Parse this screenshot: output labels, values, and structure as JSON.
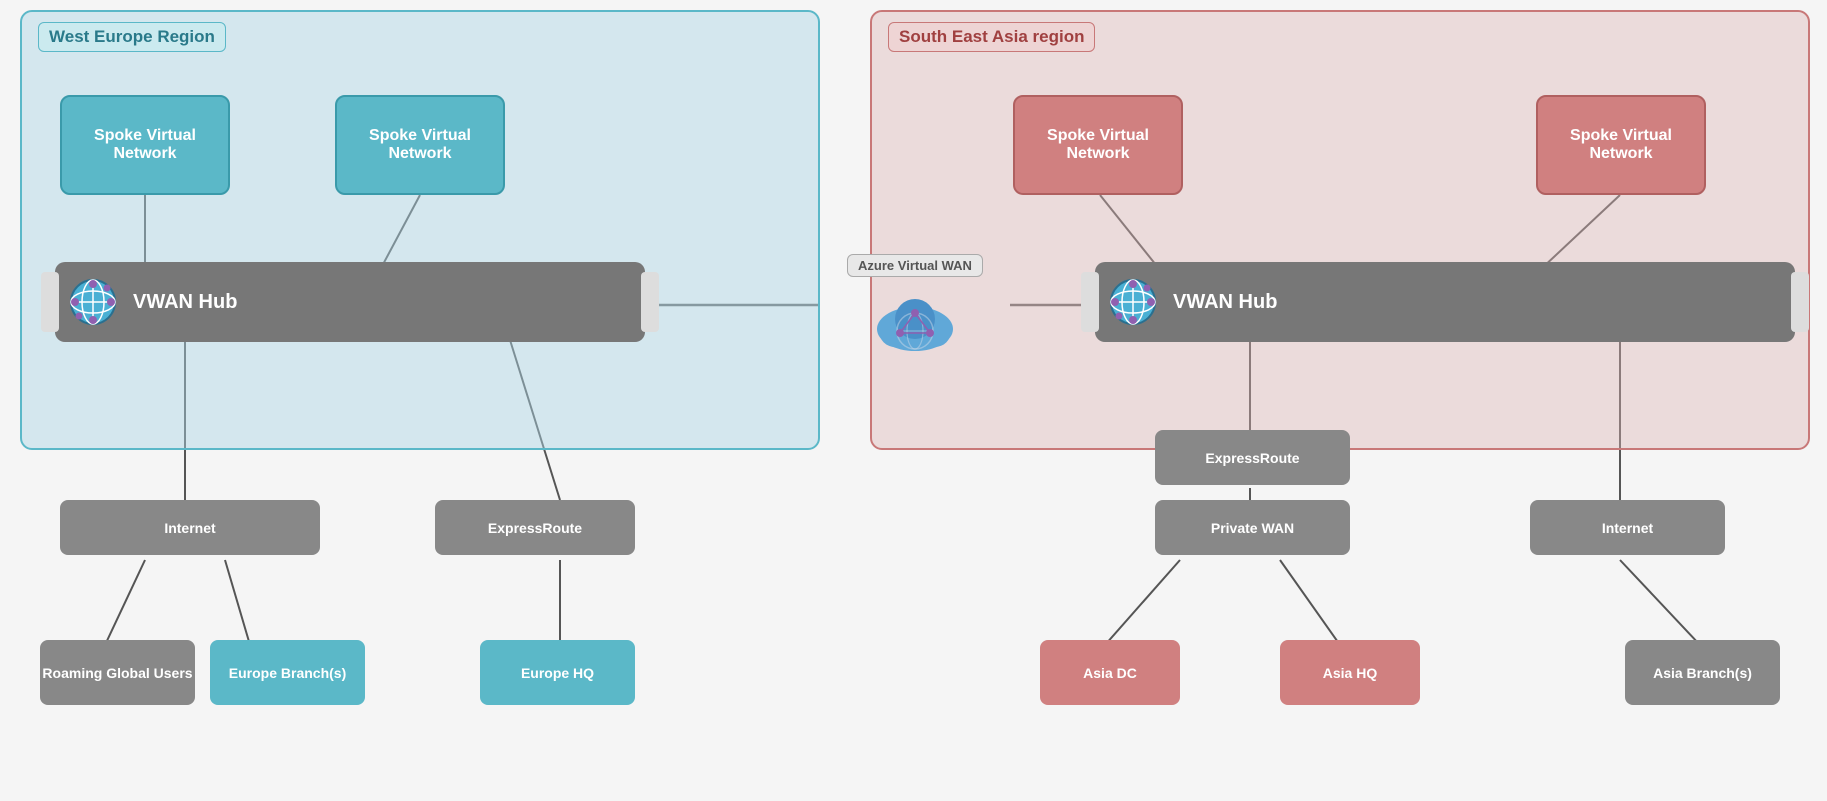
{
  "regions": {
    "west": {
      "label": "West Europe Region"
    },
    "asia": {
      "label": "South East Asia region"
    }
  },
  "spoke_networks": {
    "label": "Spoke Virtual Network"
  },
  "hubs": {
    "label": "VWAN Hub"
  },
  "azure_wan": {
    "label": "Azure Virtual WAN"
  },
  "connectors": {
    "internet": "Internet",
    "expressroute": "ExpressRoute",
    "private_wan": "Private WAN",
    "expressroute2": "ExpressRoute"
  },
  "end_nodes": {
    "roaming": "Roaming Global Users",
    "europe_branches": "Europe Branch(s)",
    "europe_hq": "Europe HQ",
    "asia_dc": "Asia DC",
    "asia_hq": "Asia HQ",
    "asia_branches": "Asia Branch(s)"
  }
}
